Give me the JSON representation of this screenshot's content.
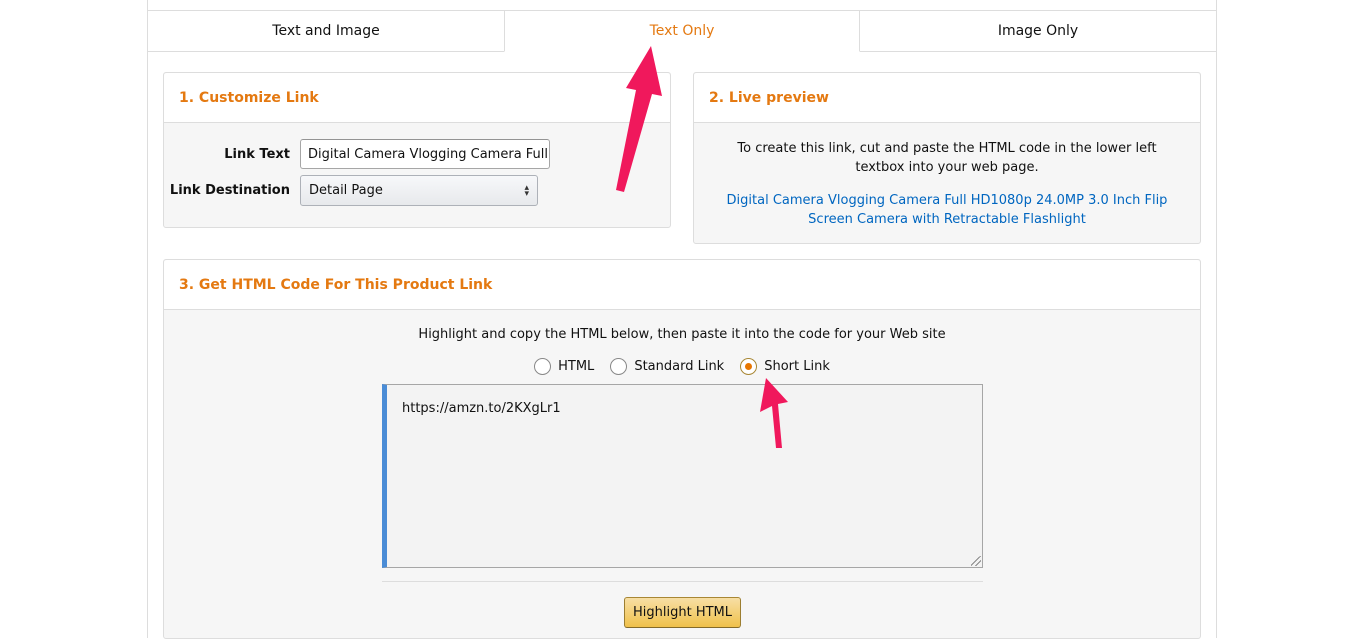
{
  "tabs": [
    {
      "label": "Text and Image",
      "active": false
    },
    {
      "label": "Text Only",
      "active": true
    },
    {
      "label": "Image Only",
      "active": false
    }
  ],
  "customize": {
    "title": "1. Customize Link",
    "link_text_label": "Link Text",
    "link_text_value": "Digital Camera Vlogging Camera Full HD",
    "link_destination_label": "Link Destination",
    "link_destination_value": "Detail Page"
  },
  "preview": {
    "title": "2. Live preview",
    "instructions": "To create this link, cut and paste the HTML code in the lower left textbox into your web page.",
    "link_text": "Digital Camera Vlogging Camera Full HD1080p 24.0MP 3.0 Inch Flip Screen Camera with Retractable Flashlight"
  },
  "html_code": {
    "title": "3. Get HTML Code For This Product Link",
    "instructions": "Highlight and copy the HTML below, then paste it into the code for your Web site",
    "options": [
      {
        "label": "HTML",
        "checked": false
      },
      {
        "label": "Standard Link",
        "checked": false
      },
      {
        "label": "Short Link",
        "checked": true
      }
    ],
    "code": "https://amzn.to/2KXgLr1",
    "highlight_button": "Highlight HTML"
  },
  "colors": {
    "accent_orange": "#e47911",
    "link_blue": "#0066c0",
    "annotation_arrow": "#f0185c",
    "textarea_left_border": "#4a8cd6"
  }
}
